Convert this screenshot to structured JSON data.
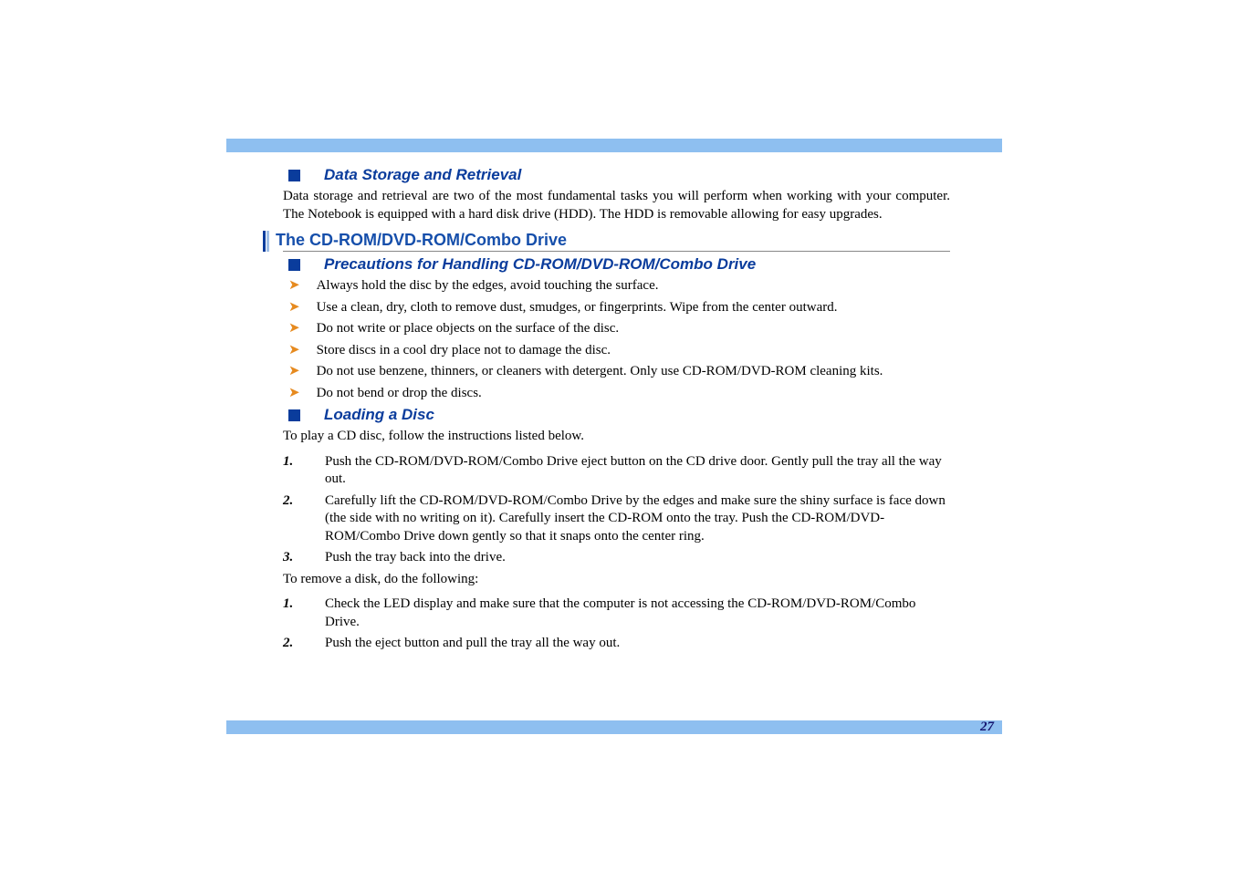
{
  "page_number": "27",
  "subheadings": {
    "data_storage": "Data Storage and Retrieval",
    "precautions": "Precautions for Handling CD-ROM/DVD-ROM/Combo Drive",
    "loading": "Loading a Disc"
  },
  "section_heading": "The CD-ROM/DVD-ROM/Combo Drive",
  "paras": {
    "data_storage": "Data storage and retrieval are two of the most fundamental tasks you will perform when working with your computer. The Notebook is equipped with a hard disk drive (HDD). The HDD is removable allowing for easy upgrades.",
    "to_play": "To play a CD disc, follow the instructions listed below.",
    "to_remove": "To remove a disk, do the following:"
  },
  "precaution_items": [
    "Always hold the disc by the edges, avoid touching the surface.",
    "Use a clean, dry, cloth to remove dust, smudges, or fingerprints. Wipe from the center outward.",
    "Do not write or place objects on the surface of the disc.",
    "Store discs in a cool dry place not to damage the disc.",
    "Do not use benzene, thinners, or cleaners with detergent. Only use CD-ROM/DVD-ROM cleaning kits.",
    "Do not bend or drop the discs."
  ],
  "load_steps": [
    {
      "n": "1.",
      "t": "Push the CD-ROM/DVD-ROM/Combo Drive eject button on the CD drive door. Gently pull the tray all the way out."
    },
    {
      "n": "2.",
      "t": "Carefully lift the CD-ROM/DVD-ROM/Combo Drive by the edges and make sure the shiny surface is face down (the side with no writing on it). Carefully insert the CD-ROM onto the tray. Push the CD-ROM/DVD-ROM/Combo Drive down gently so that it snaps onto the center ring."
    },
    {
      "n": "3.",
      "t": "Push the tray back into the drive."
    }
  ],
  "remove_steps": [
    {
      "n": "1.",
      "t": "Check the LED display and make sure that the computer is not accessing the CD-ROM/DVD-ROM/Combo Drive."
    },
    {
      "n": "2.",
      "t": "Push the eject button and pull the tray all the way out."
    }
  ]
}
